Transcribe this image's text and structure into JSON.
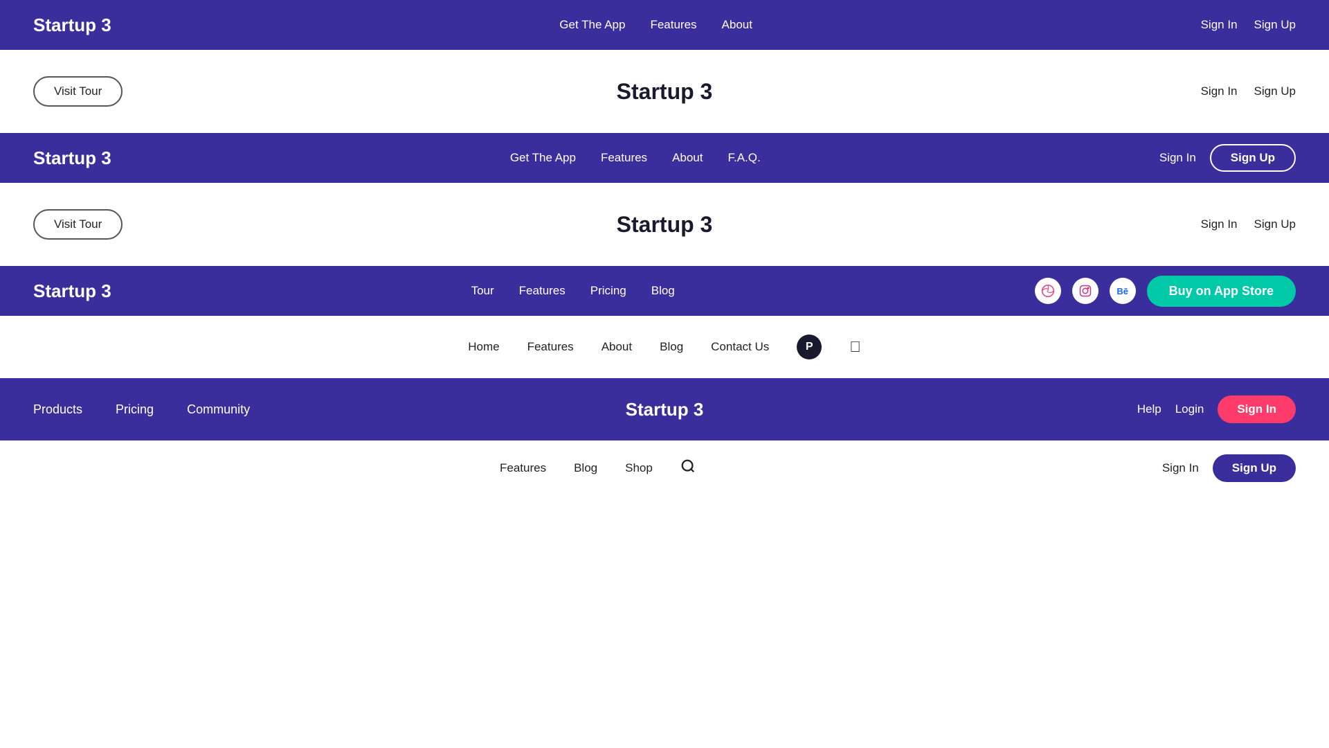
{
  "rows": [
    {
      "id": "row1",
      "brand": "Startup 3",
      "nav": [
        "Get The App",
        "Features",
        "About"
      ],
      "signIn": "Sign In",
      "signUp": "Sign Up"
    },
    {
      "id": "white1",
      "visitTour": "Visit Tour",
      "logo": "Startup 3",
      "signIn": "Sign In",
      "signUp": "Sign Up"
    },
    {
      "id": "row2",
      "brand": "Startup 3",
      "nav": [
        "Get The App",
        "Features",
        "About",
        "F.A.Q."
      ],
      "signIn": "Sign In",
      "signUp": "Sign Up"
    },
    {
      "id": "white2",
      "visitTour": "Visit Tour",
      "logo": "Startup 3",
      "signIn": "Sign In",
      "signUp": "Sign Up"
    },
    {
      "id": "row3",
      "brand": "Startup 3",
      "nav": [
        "Tour",
        "Features",
        "Pricing",
        "Blog"
      ],
      "buyBtn": "Buy on App Store"
    },
    {
      "id": "white3",
      "nav": [
        "Home",
        "Features",
        "About",
        "Blog",
        "Contact Us"
      ]
    },
    {
      "id": "row4",
      "brand": "Startup 3",
      "nav": [
        "Products",
        "Pricing",
        "Community"
      ],
      "logo": "Startup 3",
      "help": "Help",
      "login": "Login",
      "signIn": "Sign In"
    },
    {
      "id": "white4",
      "nav": [
        "Features",
        "Blog",
        "Shop"
      ],
      "signIn": "Sign In",
      "signUp": "Sign Up"
    }
  ]
}
